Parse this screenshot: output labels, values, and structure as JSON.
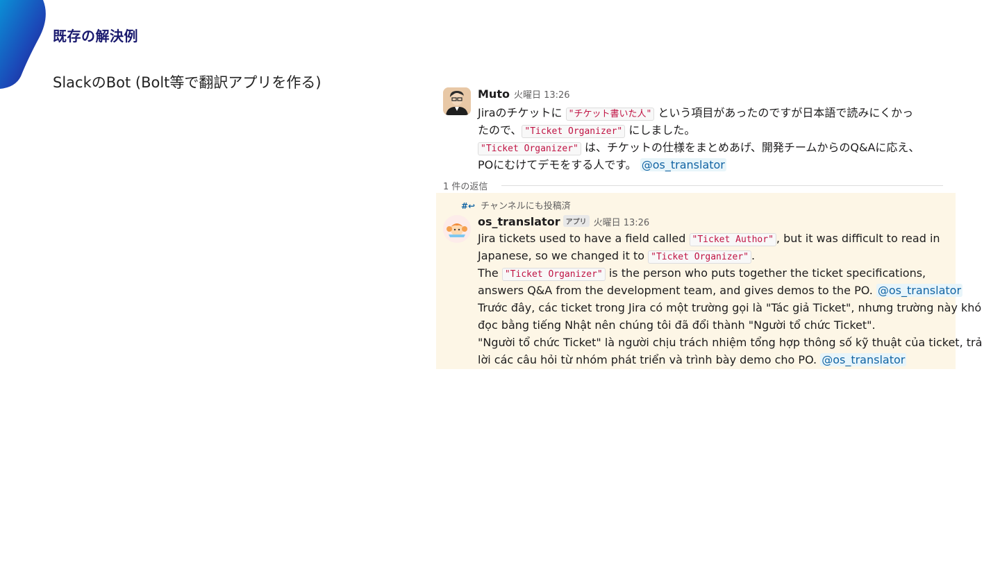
{
  "slide": {
    "title": "既存の解決例",
    "subtitle": "SlackのBot (Bolt等で翻訳アプリを作る)"
  },
  "thread": {
    "parent": {
      "author": "Muto",
      "timestamp": "火曜日 13:26",
      "lines": [
        {
          "a": "Jiraのチケットに ",
          "code": "\"チケット書いた人\"",
          "b": " という項目があったのですが日本語で読みにくかっ"
        },
        {
          "a": "たので、",
          "code": "\"Ticket Organizer\"",
          "b": " にしました。"
        },
        {
          "a": "",
          "code": "\"Ticket Organizer\"",
          "b": " は、チケットの仕様をまとめあげ、開発チームからのQ&Aに応え、"
        },
        {
          "a": "POにむけてデモをする人です。 ",
          "mention": "@os_translator"
        }
      ]
    },
    "reply_count": "1 件の返信",
    "also_sent": "チャンネルにも投稿済",
    "reply": {
      "author": "os_translator",
      "badge": "アプリ",
      "timestamp": "火曜日 13:26",
      "lines": [
        {
          "a": "Jira tickets used to have a field called ",
          "code": "\"Ticket Author\"",
          "b": ", but it was difficult to read in"
        },
        {
          "a": "Japanese, so we changed it to ",
          "code": "\"Ticket Organizer\"",
          "b": "."
        },
        {
          "a": "The ",
          "code": "\"Ticket Organizer\"",
          "b": " is the person who puts together the ticket specifications,"
        },
        {
          "a": "answers Q&A from the development team, and gives demos to the PO. ",
          "mention": "@os_translator"
        },
        {
          "a": "Trước đây, các ticket trong Jira có một trường gọi là \"Tác giả Ticket\", nhưng trường này khó"
        },
        {
          "a": "đọc bằng tiếng Nhật nên chúng tôi đã đổi thành \"Người tổ chức Ticket\"."
        },
        {
          "a": "\"Người tổ chức Ticket\" là người chịu trách nhiệm tổng hợp thông số kỹ thuật của ticket, trả"
        },
        {
          "a": "lời các câu hỏi từ nhóm phát triển và trình bày demo cho PO. ",
          "mention": "@os_translator"
        }
      ]
    }
  },
  "colors": {
    "title": "#1a1a6e",
    "mention": "#1264a3",
    "highlight": "#fdf6e6",
    "code": "#c01343"
  },
  "icons": {
    "corner": "blue-gradient-corner-shape",
    "parent_avatar": "user-avatar",
    "reply_avatar": "bot-avatar",
    "also_sent": "hash-arrow-icon"
  }
}
